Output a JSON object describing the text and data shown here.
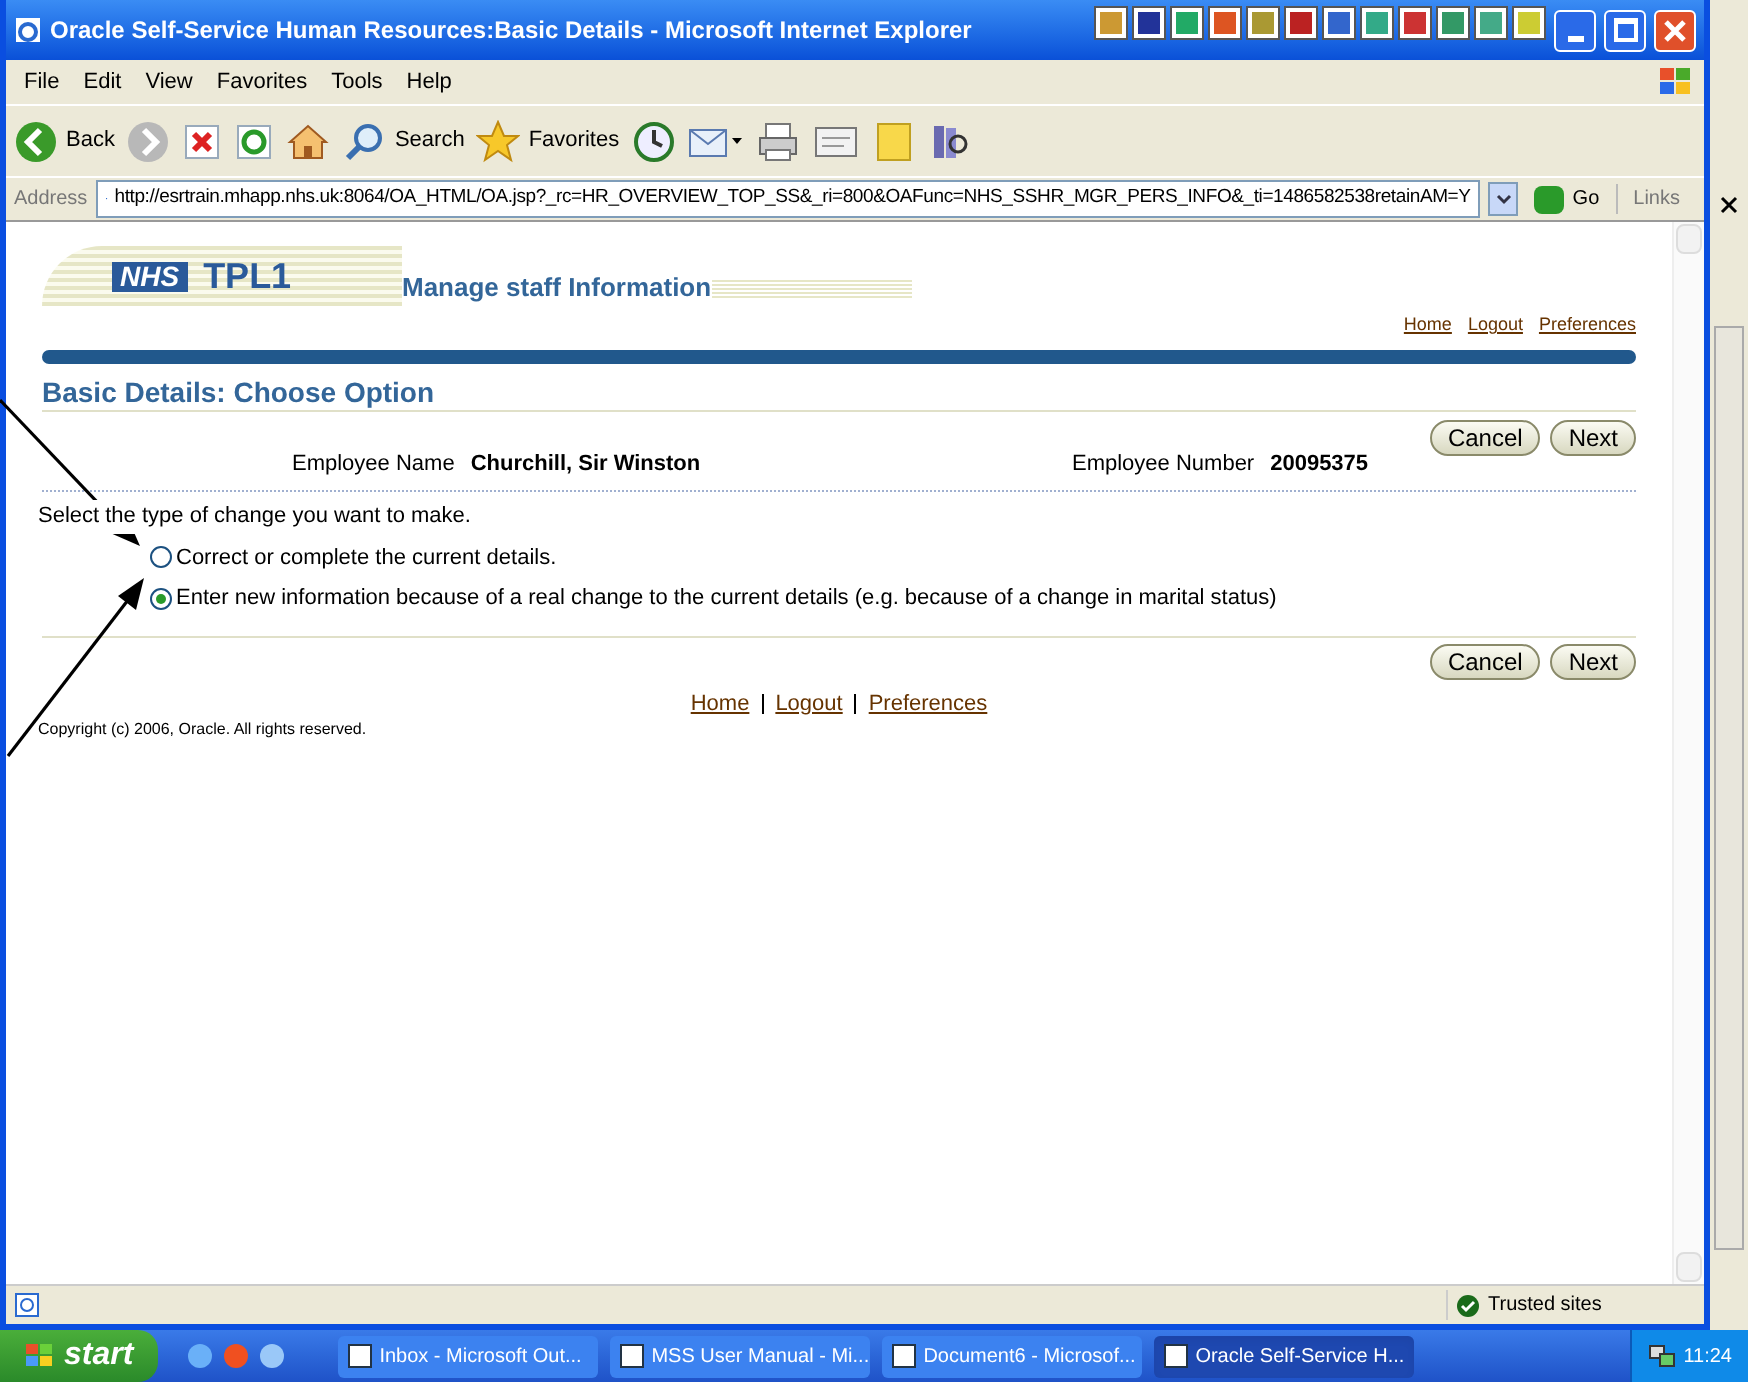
{
  "window": {
    "title": "Oracle Self-Service Human Resources:Basic Details - Microsoft Internet Explorer"
  },
  "menu": [
    "File",
    "Edit",
    "View",
    "Favorites",
    "Tools",
    "Help"
  ],
  "toolbar": [
    {
      "kind": "back",
      "label": "Back"
    },
    {
      "kind": "forward"
    },
    {
      "kind": "stop"
    },
    {
      "kind": "refresh"
    },
    {
      "kind": "home"
    },
    {
      "kind": "search",
      "label": "Search"
    },
    {
      "kind": "favorites",
      "label": "Favorites"
    },
    {
      "kind": "history"
    },
    {
      "kind": "mail"
    },
    {
      "kind": "print"
    },
    {
      "kind": "edit"
    },
    {
      "kind": "note"
    },
    {
      "kind": "research"
    }
  ],
  "address": {
    "label": "Address",
    "url": "http://esrtrain.mhapp.nhs.uk:8064/OA_HTML/OA.jsp?_rc=HR_OVERVIEW_TOP_SS&_ri=800&OAFunc=NHS_SSHR_MGR_PERS_INFO&_ti=1486582538retainAM=Y",
    "go": "Go",
    "links": "Links"
  },
  "page": {
    "logo": "NHS",
    "brand": "TPL1",
    "app_title": "Manage staff Information",
    "global_links": [
      "Home",
      "Logout",
      "Preferences"
    ],
    "heading": "Basic Details: Choose Option",
    "buttons_top": [
      "Cancel",
      "Next"
    ],
    "buttons_bottom": [
      "Cancel",
      "Next"
    ],
    "employee": [
      {
        "label": "Employee Name",
        "value": "Churchill, Sir Winston"
      },
      {
        "label": "Employee Number",
        "value": "20095375"
      }
    ],
    "instruction": "Select the type of change you want to make.",
    "options": [
      {
        "label": "Correct or complete the current details.",
        "selected": false
      },
      {
        "label": "Enter new information because of a real change to the current details (e.g. because of a change in marital status)",
        "selected": true
      }
    ],
    "footer_links": [
      "Home",
      "Logout",
      "Preferences"
    ],
    "copyright": "Copyright (c) 2006, Oracle. All rights reserved."
  },
  "status_bar": {
    "zone": "Trusted sites"
  },
  "taskbar": {
    "start": "start",
    "tasks": [
      {
        "label": "Inbox - Microsoft Out...",
        "selected": false
      },
      {
        "label": "MSS User Manual - Mi...",
        "selected": false
      },
      {
        "label": "Document6 - Microsof...",
        "selected": false
      },
      {
        "label": "Oracle Self-Service H...",
        "selected": true
      }
    ],
    "clock": "11:24"
  }
}
